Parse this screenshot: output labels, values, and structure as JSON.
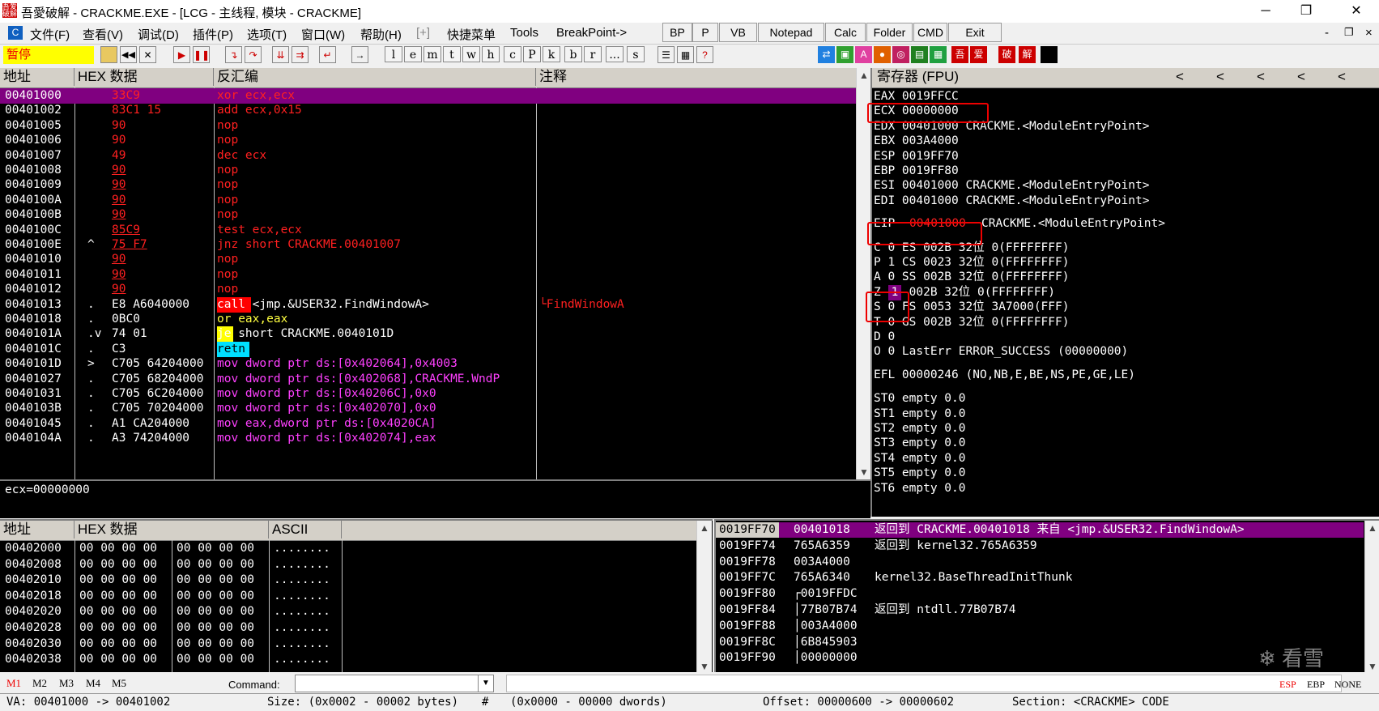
{
  "window": {
    "title": "吾愛破解 - CRACKME.EXE - [LCG - 主线程, 模块 - CRACKME]",
    "icon_text": "吾爱破解",
    "controls": [
      "─",
      "❐",
      "✕"
    ]
  },
  "menu": {
    "items": [
      "文件(F)",
      "查看(V)",
      "调试(D)",
      "插件(P)",
      "选项(T)",
      "窗口(W)",
      "帮助(H)",
      "[+]",
      "快捷菜单",
      "Tools",
      "BreakPoint->"
    ],
    "quick_buttons": [
      "BP",
      "P",
      "VB",
      "Notepad",
      "Calc",
      "Folder",
      "CMD",
      "Exit"
    ],
    "mdi_controls": [
      "-",
      "❐",
      "×"
    ]
  },
  "toolbar": {
    "status": "暂停",
    "letters": [
      "l",
      "e",
      "m",
      "t",
      "w",
      "h",
      "c",
      "P",
      "k",
      "b",
      "r",
      "...",
      "s"
    ],
    "right_icons": [
      "吾",
      "爱",
      "破",
      "解"
    ]
  },
  "disasm": {
    "headers": [
      "地址",
      "HEX 数据",
      "反汇编",
      "注释"
    ],
    "rows": [
      {
        "addr": "00401000",
        "mark": "",
        "hex": "33C9",
        "asm": "xor ecx,ecx",
        "comment": ""
      },
      {
        "addr": "00401002",
        "mark": "",
        "hex": "83C1 15",
        "asm": "add ecx,0x15",
        "comment": ""
      },
      {
        "addr": "00401005",
        "mark": "",
        "hex": "90",
        "asm": "nop",
        "comment": ""
      },
      {
        "addr": "00401006",
        "mark": "",
        "hex": "90",
        "asm": "nop",
        "comment": ""
      },
      {
        "addr": "00401007",
        "mark": "",
        "hex": "49",
        "asm": "dec ecx",
        "comment": ""
      },
      {
        "addr": "00401008",
        "mark": "",
        "hex": "90",
        "asm": "nop",
        "comment": ""
      },
      {
        "addr": "00401009",
        "mark": "",
        "hex": "90",
        "asm": "nop",
        "comment": ""
      },
      {
        "addr": "0040100A",
        "mark": "",
        "hex": "90",
        "asm": "nop",
        "comment": ""
      },
      {
        "addr": "0040100B",
        "mark": "",
        "hex": "90",
        "asm": "nop",
        "comment": ""
      },
      {
        "addr": "0040100C",
        "mark": "",
        "hex": "85C9",
        "asm": "test ecx,ecx",
        "comment": ""
      },
      {
        "addr": "0040100E",
        "mark": "^",
        "hex": "75 F7",
        "asm": "jnz short CRACKME.00401007",
        "comment": ""
      },
      {
        "addr": "00401010",
        "mark": "",
        "hex": "90",
        "asm": "nop",
        "comment": ""
      },
      {
        "addr": "00401011",
        "mark": "",
        "hex": "90",
        "asm": "nop",
        "comment": ""
      },
      {
        "addr": "00401012",
        "mark": "",
        "hex": "90",
        "asm": "nop",
        "comment": ""
      },
      {
        "addr": "00401013",
        "mark": ".",
        "hex": "E8 A6040000",
        "asm": "call <jmp.&USER32.FindWindowA>",
        "comment": "└FindWindowA"
      },
      {
        "addr": "00401018",
        "mark": ".",
        "hex": "0BC0",
        "asm": "or eax,eax",
        "comment": ""
      },
      {
        "addr": "0040101A",
        "mark": ".v",
        "hex": "74 01",
        "asm": "je short CRACKME.0040101D",
        "comment": ""
      },
      {
        "addr": "0040101C",
        "mark": ".",
        "hex": "C3",
        "asm": "retn",
        "comment": ""
      },
      {
        "addr": "0040101D",
        "mark": ">",
        "hex": "C705 64204000",
        "asm": "mov dword ptr ds:[0x402064],0x4003",
        "comment": ""
      },
      {
        "addr": "00401027",
        "mark": ".",
        "hex": "C705 68204000",
        "asm": "mov dword ptr ds:[0x402068],CRACKME.WndP",
        "comment": ""
      },
      {
        "addr": "00401031",
        "mark": ".",
        "hex": "C705 6C204000",
        "asm": "mov dword ptr ds:[0x40206C],0x0",
        "comment": ""
      },
      {
        "addr": "0040103B",
        "mark": ".",
        "hex": "C705 70204000",
        "asm": "mov dword ptr ds:[0x402070],0x0",
        "comment": ""
      },
      {
        "addr": "00401045",
        "mark": ".",
        "hex": "A1 CA204000",
        "asm": "mov eax,dword ptr ds:[0x4020CA]",
        "comment": ""
      },
      {
        "addr": "0040104A",
        "mark": ".",
        "hex": "A3 74204000",
        "asm": "mov dword ptr ds:[0x402074],eax",
        "comment": ""
      }
    ],
    "info_line": "ecx=00000000"
  },
  "registers": {
    "header": "寄存器 (FPU)",
    "nav": [
      "<",
      "<",
      "<",
      "<",
      "<"
    ],
    "gpr": [
      "EAX 0019FFCC",
      "ECX 00000000",
      "EDX 00401000 CRACKME.<ModuleEntryPoint>",
      "EBX 003A4000",
      "ESP 0019FF70",
      "EBP 0019FF80",
      "ESI 00401000 CRACKME.<ModuleEntryPoint>",
      "EDI 00401000 CRACKME.<ModuleEntryPoint>"
    ],
    "eip_label": "EIP",
    "eip_value": "00401000",
    "eip_desc": "CRACKME.<ModuleEntryPoint>",
    "flags": [
      "C 0  ES 002B 32位 0(FFFFFFFF)",
      "P 1  CS 0023 32位 0(FFFFFFFF)",
      "A 0  SS 002B 32位 0(FFFFFFFF)",
      "Z    DS 002B 32位 0(FFFFFFFF)",
      "S 0  FS 0053 32位 3A7000(FFF)",
      "T 0  GS 002B 32位 0(FFFFFFFF)",
      "D 0",
      "O 0  LastErr ERROR_SUCCESS (00000000)"
    ],
    "zf_value": "1",
    "efl": "EFL 00000246 (NO,NB,E,BE,NS,PE,GE,LE)",
    "fpu": [
      "ST0 empty 0.0",
      "ST1 empty 0.0",
      "ST2 empty 0.0",
      "ST3 empty 0.0",
      "ST4 empty 0.0",
      "ST5 empty 0.0",
      "ST6 empty 0.0"
    ]
  },
  "dump": {
    "headers": [
      "地址",
      "HEX 数据",
      "ASCII"
    ],
    "rows": [
      {
        "addr": "00402000",
        "hex1": "00 00 00 00",
        "hex2": "00 00 00 00",
        "ascii": "........"
      },
      {
        "addr": "00402008",
        "hex1": "00 00 00 00",
        "hex2": "00 00 00 00",
        "ascii": "........"
      },
      {
        "addr": "00402010",
        "hex1": "00 00 00 00",
        "hex2": "00 00 00 00",
        "ascii": "........"
      },
      {
        "addr": "00402018",
        "hex1": "00 00 00 00",
        "hex2": "00 00 00 00",
        "ascii": "........"
      },
      {
        "addr": "00402020",
        "hex1": "00 00 00 00",
        "hex2": "00 00 00 00",
        "ascii": "........"
      },
      {
        "addr": "00402028",
        "hex1": "00 00 00 00",
        "hex2": "00 00 00 00",
        "ascii": "........"
      },
      {
        "addr": "00402030",
        "hex1": "00 00 00 00",
        "hex2": "00 00 00 00",
        "ascii": "........"
      },
      {
        "addr": "00402038",
        "hex1": "00 00 00 00",
        "hex2": "00 00 00 00",
        "ascii": "........"
      }
    ]
  },
  "stack": {
    "rows": [
      {
        "addr": "0019FF70",
        "val": "00401018",
        "comment": "返回到 CRACKME.00401018 来自 <jmp.&USER32.FindWindowA>"
      },
      {
        "addr": "0019FF74",
        "val": "765A6359",
        "comment": "返回到 kernel32.765A6359"
      },
      {
        "addr": "0019FF78",
        "val": "003A4000",
        "comment": ""
      },
      {
        "addr": "0019FF7C",
        "val": "765A6340",
        "comment": "kernel32.BaseThreadInitThunk"
      },
      {
        "addr": "0019FF80",
        "val": "┌0019FFDC",
        "comment": ""
      },
      {
        "addr": "0019FF84",
        "val": "│77B07B74",
        "comment": "返回到 ntdll.77B07B74"
      },
      {
        "addr": "0019FF88",
        "val": "│003A4000",
        "comment": ""
      },
      {
        "addr": "0019FF8C",
        "val": "│6B845903",
        "comment": ""
      },
      {
        "addr": "0019FF90",
        "val": "│00000000",
        "comment": ""
      }
    ],
    "watermark": "看雪"
  },
  "commandbar": {
    "tabs": [
      "M1",
      "M2",
      "M3",
      "M4",
      "M5"
    ],
    "label": "Command:",
    "right": [
      "ESP",
      "EBP",
      "NONE"
    ]
  },
  "statusbar": {
    "va": "VA: 00401000 -> 00401002",
    "size": "Size: (0x0002 - 00002 bytes)",
    "hash": "#",
    "dwords": "(0x0000 - 00000 dwords)",
    "offset": "Offset: 00000600 -> 00000602",
    "section": "Section: <CRACKME> CODE"
  },
  "colors": {
    "selected_row": "#800080",
    "highlight_red": "#ff0000",
    "annotation_box": "#e00000",
    "pane_bg": "#000000"
  }
}
